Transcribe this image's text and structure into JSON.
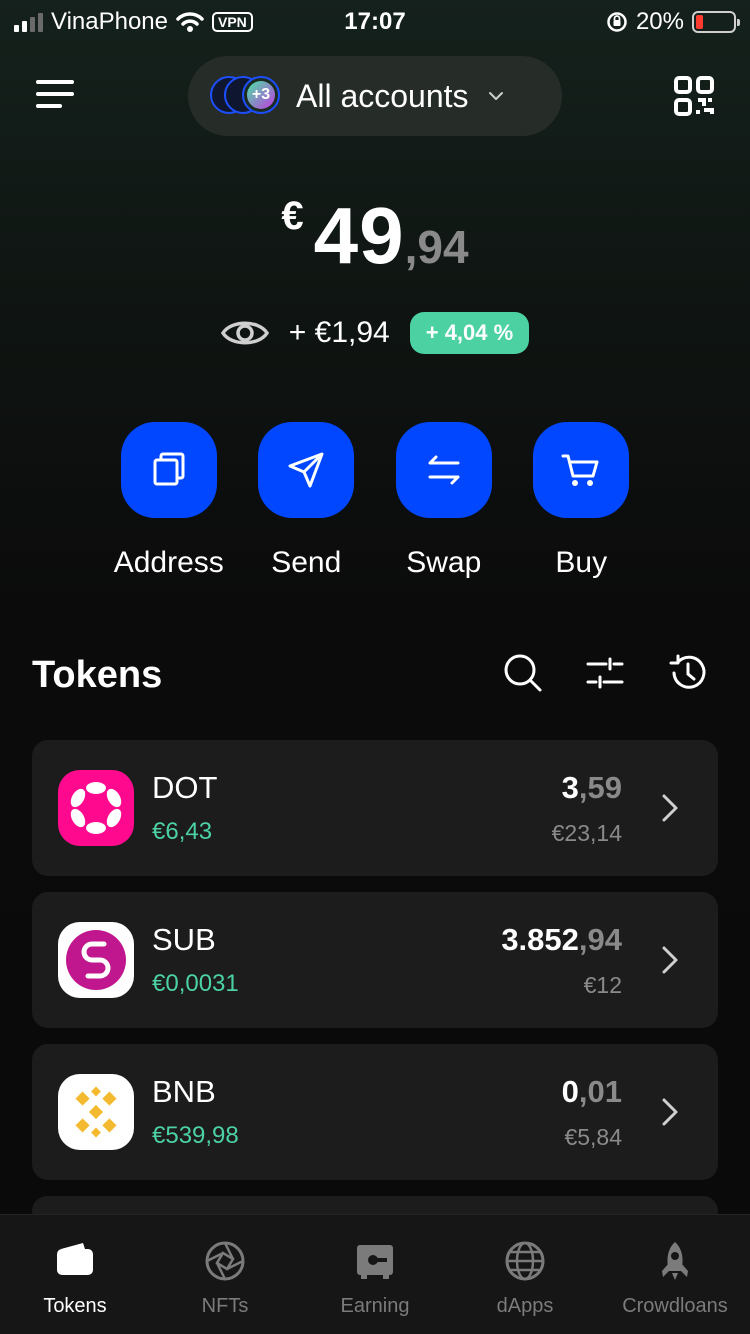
{
  "status_bar": {
    "carrier": "VinaPhone",
    "vpn": "VPN",
    "time": "17:07",
    "battery": "20%",
    "battery_level": 0.2,
    "battery_color": "#ff3b30"
  },
  "header": {
    "account_selector": "All accounts",
    "extra_accounts_badge": "+3"
  },
  "balance": {
    "currency": "€",
    "integer": "49",
    "decimal": ",94"
  },
  "change": {
    "amount": "+ €1,94",
    "percent": "+ 4,04 %"
  },
  "actions": [
    {
      "label": "Address",
      "icon": "copy-icon"
    },
    {
      "label": "Send",
      "icon": "send-icon"
    },
    {
      "label": "Swap",
      "icon": "swap-icon"
    },
    {
      "label": "Buy",
      "icon": "cart-icon"
    }
  ],
  "tokens": {
    "title": "Tokens",
    "items": [
      {
        "symbol": "DOT",
        "price": "€6,43",
        "balance_int": "3",
        "balance_dec": ",59",
        "value": "€23,14",
        "logo_color": "#ff0a8f"
      },
      {
        "symbol": "SUB",
        "price": "€0,0031",
        "balance_int": "3.852",
        "balance_dec": ",94",
        "value": "€12",
        "logo_color": "#c0168e"
      },
      {
        "symbol": "BNB",
        "price": "€539,98",
        "balance_int": "0",
        "balance_dec": ",01",
        "value": "€5,84",
        "logo_color": "#f3ba2f"
      }
    ]
  },
  "bottom_nav": [
    {
      "label": "Tokens",
      "icon": "wallet-icon",
      "active": true
    },
    {
      "label": "NFTs",
      "icon": "aperture-icon",
      "active": false
    },
    {
      "label": "Earning",
      "icon": "safe-icon",
      "active": false
    },
    {
      "label": "dApps",
      "icon": "globe-icon",
      "active": false
    },
    {
      "label": "Crowdloans",
      "icon": "rocket-icon",
      "active": false
    }
  ],
  "colors": {
    "accent": "#0047ff",
    "positive": "#4cd1a3",
    "card": "#1c1c1c"
  }
}
